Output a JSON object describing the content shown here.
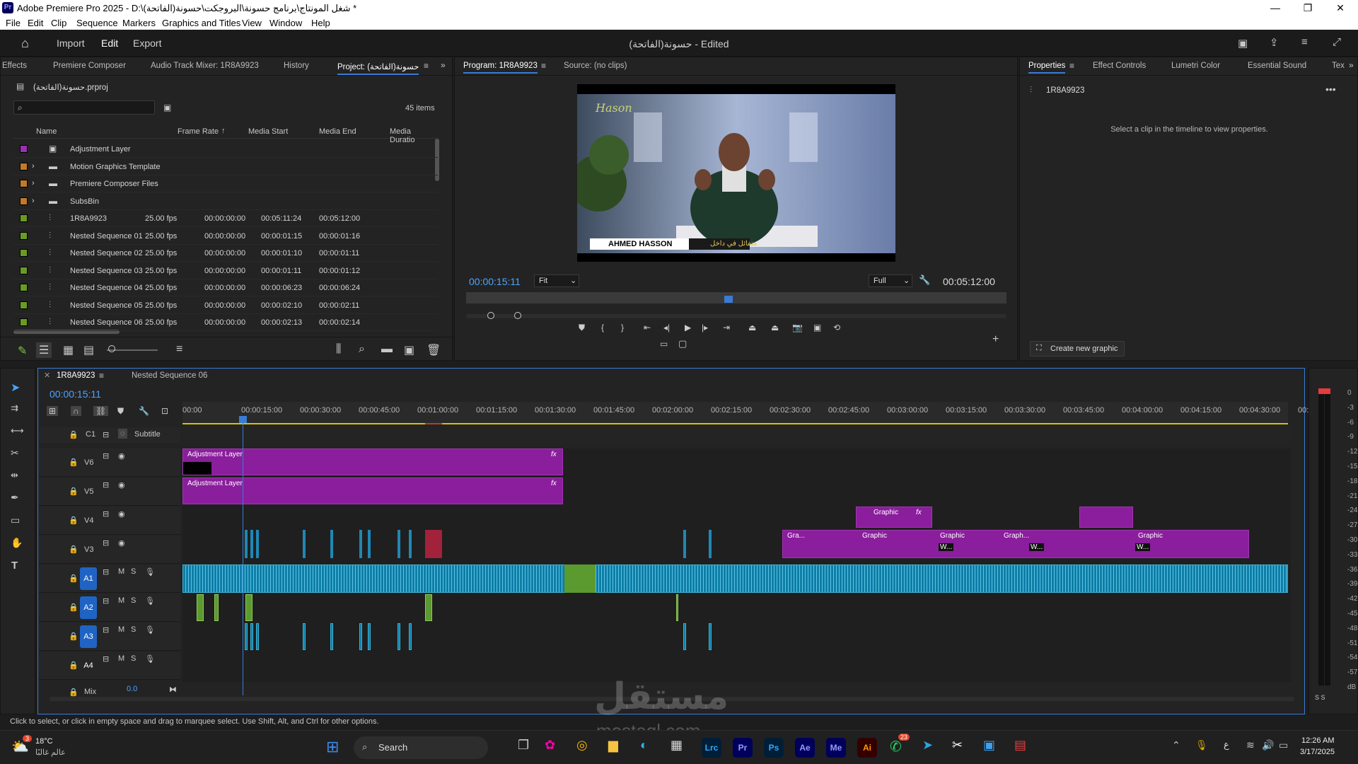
{
  "window": {
    "app_title": "Adobe Premiere Pro 2025 - D:\\شغل المونتاج\\برنامج حسونة\\البروجكت\\حسونة(الفاتحة) *",
    "logo_text": "Pr",
    "minimize": "—",
    "maximize": "❐",
    "close": "✕"
  },
  "menu": [
    "File",
    "Edit",
    "Clip",
    "Sequence",
    "Markers",
    "Graphics and Titles",
    "View",
    "Window",
    "Help"
  ],
  "workspace": {
    "import": "Import",
    "edit": "Edit",
    "export": "Export",
    "project_title": "حسونة(الفاتحة) - Edited"
  },
  "left_tabs": [
    "Effects",
    "Premiere Composer",
    "Audio Track Mixer: 1R8A9923",
    "History",
    "Project: حسونة(الفاتحة)"
  ],
  "project": {
    "file_name": "حسونة(الفاتحة).prproj",
    "items_count": "45 items",
    "search_placeholder": "",
    "columns": [
      "Name",
      "Frame Rate",
      "Media Start",
      "Media End",
      "Media Duratio"
    ],
    "rows": [
      {
        "name": "Adjustment Layer",
        "color": "#9b2fb0",
        "fps": "",
        "start": "",
        "end": "",
        "dur": ""
      },
      {
        "name": "Motion Graphics Template",
        "color": "#c07a2a",
        "fps": "",
        "start": "",
        "end": "",
        "dur": ""
      },
      {
        "name": "Premiere Composer Files",
        "color": "#c07a2a",
        "fps": "",
        "start": "",
        "end": "",
        "dur": ""
      },
      {
        "name": "SubsBin",
        "color": "#c07a2a",
        "fps": "",
        "start": "",
        "end": "",
        "dur": ""
      },
      {
        "name": "1R8A9923",
        "color": "#6a9a26",
        "fps": "25.00 fps",
        "start": "00:00:00:00",
        "end": "00:05:11:24",
        "dur": "00:05:12:00"
      },
      {
        "name": "Nested Sequence 01",
        "color": "#6a9a26",
        "fps": "25.00 fps",
        "start": "00:00:00:00",
        "end": "00:00:01:15",
        "dur": "00:00:01:16"
      },
      {
        "name": "Nested Sequence 02",
        "color": "#6a9a26",
        "fps": "25.00 fps",
        "start": "00:00:00:00",
        "end": "00:00:01:10",
        "dur": "00:00:01:11"
      },
      {
        "name": "Nested Sequence 03",
        "color": "#6a9a26",
        "fps": "25.00 fps",
        "start": "00:00:00:00",
        "end": "00:00:01:11",
        "dur": "00:00:01:12"
      },
      {
        "name": "Nested Sequence 04",
        "color": "#6a9a26",
        "fps": "25.00 fps",
        "start": "00:00:00:00",
        "end": "00:00:06:23",
        "dur": "00:00:06:24"
      },
      {
        "name": "Nested Sequence 05",
        "color": "#6a9a26",
        "fps": "25.00 fps",
        "start": "00:00:00:00",
        "end": "00:00:02:10",
        "dur": "00:00:02:11"
      },
      {
        "name": "Nested Sequence 06",
        "color": "#6a9a26",
        "fps": "25.00 fps",
        "start": "00:00:00:00",
        "end": "00:00:02:13",
        "dur": "00:00:02:14"
      }
    ]
  },
  "program": {
    "tab": "Program: 1R8A9923",
    "source_tab": "Source: (no clips)",
    "timecode": "00:00:15:11",
    "fit": "Fit",
    "quality": "Full",
    "duration": "00:05:12:00",
    "overlay_logo": "Hason",
    "lower_third_name": "AHMED HASSON",
    "lower_third_text": "متفائل في داخل"
  },
  "properties": {
    "tabs": [
      "Properties",
      "Effect Controls",
      "Lumetri Color",
      "Essential Sound",
      "Tex"
    ],
    "clip": "1R8A9923",
    "hint": "Select a clip in the timeline to view properties.",
    "create_graphic": "Create new graphic"
  },
  "timeline": {
    "tabs": [
      "1R8A9923",
      "Nested Sequence 06"
    ],
    "timecode": "00:00:15:11",
    "ruler": [
      "00:00",
      "00:00:15:00",
      "00:00:30:00",
      "00:00:45:00",
      "00:01:00:00",
      "00:01:15:00",
      "00:01:30:00",
      "00:01:45:00",
      "00:02:00:00",
      "00:02:15:00",
      "00:02:30:00",
      "00:02:45:00",
      "00:03:00:00",
      "00:03:15:00",
      "00:03:30:00",
      "00:03:45:00",
      "00:04:00:00",
      "00:04:15:00",
      "00:04:30:00",
      "00:"
    ],
    "caption_track": "C1",
    "caption_label": "Subtitle",
    "video_tracks": [
      "V6",
      "V5",
      "V4",
      "V3"
    ],
    "audio_tracks": [
      "A1",
      "A2",
      "A3",
      "A4"
    ],
    "mix_label": "Mix",
    "mix_value": "0.0",
    "adjustment_label": "Adjustment Layer",
    "graphic_label": "Graphic",
    "graphic_short": "Gra...",
    "graph_short": "Graph...",
    "w_label": "W...",
    "fx": "fx",
    "mute": "M",
    "solo": "S"
  },
  "meter": {
    "marks": [
      "0",
      "-3",
      "-6",
      "-9",
      "-12",
      "-15",
      "-18",
      "-21",
      "-24",
      "-27",
      "-30",
      "-33",
      "-36",
      "-39",
      "-42",
      "-45",
      "-48",
      "-51",
      "-54",
      "-57",
      "dB"
    ],
    "solo_labels": "S  S"
  },
  "status": "Click to select, or click in empty space and drag to marquee select. Use Shift, Alt, and Ctrl for other options.",
  "watermark": {
    "arabic": "مستقل",
    "latin": "mostaql.com"
  },
  "taskbar": {
    "temp": "18°C",
    "weather": "عالم غالبًا",
    "weather_badge": "3",
    "search": "Search",
    "time": "12:26 AM",
    "date": "3/17/2025",
    "lang": "ع",
    "whatsapp_badge": "23",
    "apps": [
      "Lrc",
      "Pr",
      "Ps",
      "Ae",
      "Me",
      "Ai"
    ]
  }
}
